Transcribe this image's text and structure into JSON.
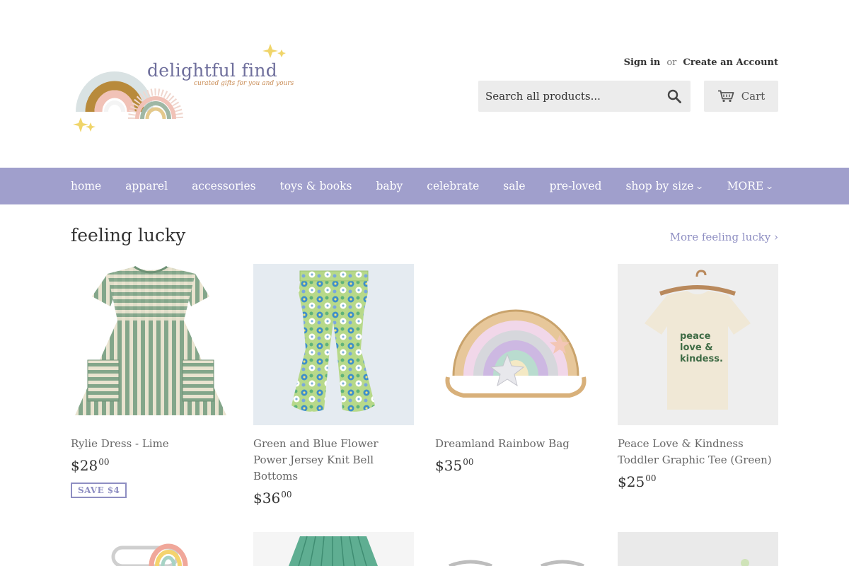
{
  "brand": {
    "name": "delightful find",
    "tagline": "curated gifts for you and yours"
  },
  "account": {
    "sign_in": "Sign in",
    "or": "or",
    "create_account": "Create an Account"
  },
  "search": {
    "placeholder": "Search all products..."
  },
  "cart": {
    "label": "Cart",
    "icon": "cart-icon"
  },
  "nav": {
    "items": [
      {
        "label": "home"
      },
      {
        "label": "apparel"
      },
      {
        "label": "accessories"
      },
      {
        "label": "toys & books"
      },
      {
        "label": "baby"
      },
      {
        "label": "celebrate"
      },
      {
        "label": "sale"
      },
      {
        "label": "pre-loved"
      },
      {
        "label": "shop by size",
        "dropdown": true
      },
      {
        "label": "MORE",
        "dropdown": true
      }
    ]
  },
  "section": {
    "title": "feeling lucky",
    "more_link": "More feeling lucky ›"
  },
  "products": [
    {
      "name": "Rylie Dress - Lime",
      "price_dollars": "$28",
      "price_cents": "00",
      "badge": "SAVE $4"
    },
    {
      "name": "Green and Blue Flower Power Jersey Knit Bell Bottoms",
      "price_dollars": "$36",
      "price_cents": "00"
    },
    {
      "name": "Dreamland Rainbow Bag",
      "price_dollars": "$35",
      "price_cents": "00"
    },
    {
      "name": "Peace Love & Kindness Toddler Graphic Tee (Green)",
      "price_dollars": "$25",
      "price_cents": "00",
      "tee_text": "peace love & kindess."
    }
  ],
  "colors": {
    "nav_bg": "#a09fcc",
    "accent": "#8e8ec2",
    "search_bg": "#ececec"
  }
}
